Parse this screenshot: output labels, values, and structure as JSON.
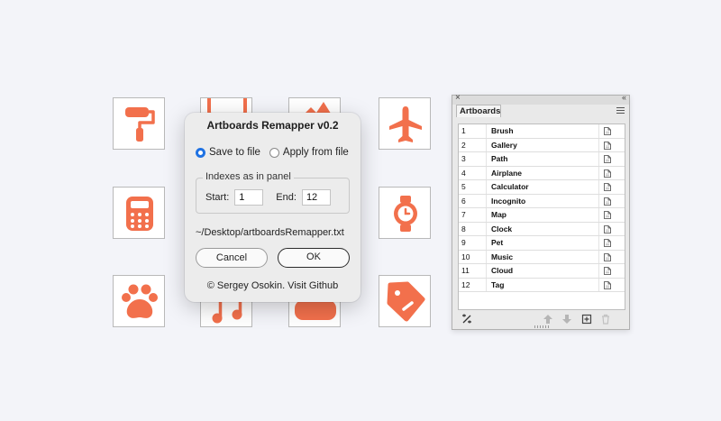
{
  "colors": {
    "icon_fill": "#f2704c",
    "accent": "#1f72e3"
  },
  "tiles": [
    {
      "icon": "paint-roller-icon"
    },
    {
      "icon": "gallery-icon"
    },
    {
      "icon": "path-icon"
    },
    {
      "icon": "airplane-icon"
    },
    {
      "icon": "calculator-icon"
    },
    {
      "icon": "clock-icon"
    },
    {
      "icon": "paw-icon"
    },
    {
      "icon": "music-icon"
    },
    {
      "icon": "cloud-icon"
    },
    {
      "icon": "tag-icon"
    }
  ],
  "dialog": {
    "title": "Artboards Remapper v0.2",
    "save_label": "Save to file",
    "apply_label": "Apply from file",
    "selected_mode": "save",
    "group_label": "Indexes as in panel",
    "start_label": "Start:",
    "start_value": "1",
    "end_label": "End:",
    "end_value": "12",
    "path": "~/Desktop/artboardsRemapper.txt",
    "cancel_label": "Cancel",
    "ok_label": "OK",
    "credit": "© Sergey Osokin. Visit Github"
  },
  "panel": {
    "close_glyph": "×",
    "collapse_glyph": "‹‹",
    "tab_label": "Artboards",
    "rows": [
      {
        "index": "1",
        "name": "Brush"
      },
      {
        "index": "2",
        "name": "Gallery"
      },
      {
        "index": "3",
        "name": "Path"
      },
      {
        "index": "4",
        "name": "Airplane"
      },
      {
        "index": "5",
        "name": "Calculator"
      },
      {
        "index": "6",
        "name": "Incognito"
      },
      {
        "index": "7",
        "name": "Map"
      },
      {
        "index": "8",
        "name": "Clock"
      },
      {
        "index": "9",
        "name": "Pet"
      },
      {
        "index": "10",
        "name": "Music"
      },
      {
        "index": "11",
        "name": "Cloud"
      },
      {
        "index": "12",
        "name": "Tag"
      }
    ]
  }
}
